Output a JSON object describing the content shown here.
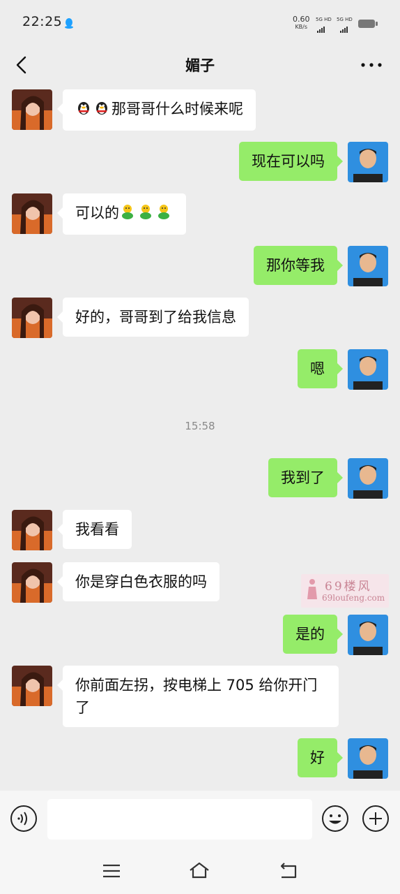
{
  "status_bar": {
    "time": "22:25",
    "net_speed": "0.60",
    "net_unit": "KB/s",
    "sim1": "5G HD",
    "sim2": "5G HD"
  },
  "header": {
    "title": "媚子"
  },
  "colors": {
    "background": "#ededed",
    "incoming_bubble": "#ffffff",
    "outgoing_bubble": "#95ec69",
    "timestamp_text": "#8a8a8a"
  },
  "messages": [
    {
      "side": "left",
      "emoji_prefix": "penguin-emoji x2",
      "text": "那哥哥什么时候来呢"
    },
    {
      "side": "right",
      "text": "现在可以吗"
    },
    {
      "side": "left",
      "text": "可以的",
      "emoji_suffix": "cute-emoji x3"
    },
    {
      "side": "right",
      "text": "那你等我"
    },
    {
      "side": "left",
      "text": "好的，哥哥到了给我信息"
    },
    {
      "side": "right",
      "text": "嗯"
    },
    {
      "side": "right",
      "text": "我到了"
    },
    {
      "side": "left",
      "text": "我看看"
    },
    {
      "side": "left",
      "text": "你是穿白色衣服的吗"
    },
    {
      "side": "right",
      "text": "是的"
    },
    {
      "side": "left",
      "text": "你前面左拐，按电梯上 705 给你开门了"
    },
    {
      "side": "right",
      "text": "好"
    }
  ],
  "timestamp": "15:58",
  "watermark": {
    "text_cn": "69楼风",
    "text_en": "69loufeng.com"
  },
  "input": {
    "value": "",
    "placeholder": ""
  },
  "icons": {
    "back": "back-arrow-icon",
    "more": "more-dots-icon",
    "voice": "voice-icon",
    "emoji": "emoji-icon",
    "plus": "plus-icon",
    "nav_menu": "menu-icon",
    "nav_home": "home-icon",
    "nav_back": "back-nav-icon"
  }
}
